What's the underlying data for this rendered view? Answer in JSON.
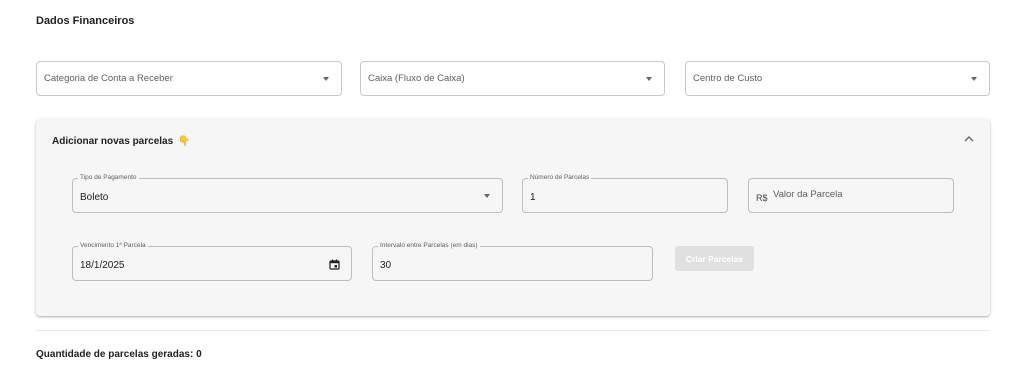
{
  "section": {
    "title": "Dados Financeiros"
  },
  "selects": {
    "categoria": {
      "placeholder": "Categoria de Conta a Receber"
    },
    "caixa": {
      "placeholder": "Caixa (Fluxo de Caixa)"
    },
    "centro": {
      "placeholder": "Centro de Custo"
    }
  },
  "panel": {
    "title": "Adicionar novas parcelas",
    "emoji": "👇",
    "tipo_pagamento": {
      "label": "Tipo de Pagamento",
      "value": "Boleto"
    },
    "numero_parcelas": {
      "label": "Número de Parcelas",
      "value": "1"
    },
    "valor_parcela": {
      "prefix": "R$",
      "placeholder": "Valor da Parcela"
    },
    "vencimento": {
      "label": "Vencimento 1ª Parcela",
      "value": "18/1/2025"
    },
    "intervalo": {
      "label": "Intervalo entre Parcelas (em dias)",
      "value": "30"
    },
    "criar_button": "Criar Parcelas"
  },
  "summary": {
    "label": "Quantidade de parcelas geradas:",
    "value": "0"
  },
  "colors": {
    "panel_bg": "#f6f6f6",
    "border": "#c8c8c8",
    "button_disabled": "#e0e0e0"
  },
  "icons": [
    "chevron-down-icon",
    "chevron-up-icon",
    "calendar-icon",
    "pointing-down-emoji"
  ]
}
